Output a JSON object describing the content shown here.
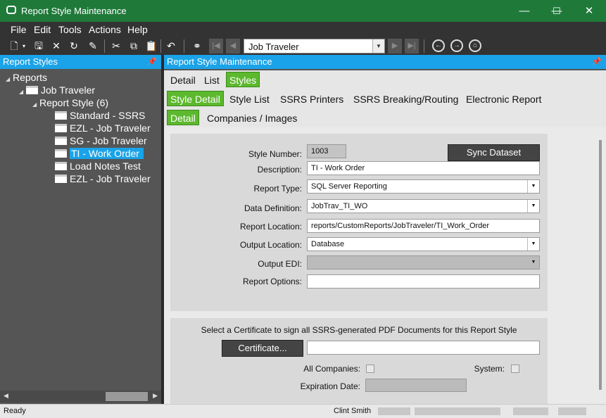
{
  "window": {
    "title": "Report Style Maintenance",
    "min": "—",
    "max": "☐",
    "close": "✕"
  },
  "menu": [
    "File",
    "Edit",
    "Tools",
    "Actions",
    "Help"
  ],
  "toolbar": {
    "nav_value": "Job Traveler"
  },
  "left_panel": {
    "title": "Report Styles",
    "tree": {
      "root": "Reports",
      "group": "Job Traveler",
      "subgroup": "Report Style (6)",
      "items": [
        "Standard - SSRS",
        "EZL - Job Traveler",
        "SG - Job Traveler",
        "TI - Work Order",
        "Load Notes Test",
        "EZL - Job Traveler"
      ],
      "selected_index": 3
    }
  },
  "right_panel": {
    "title": "Report Style Maintenance",
    "tabs_l1": [
      "Detail",
      "List",
      "Styles"
    ],
    "tabs_l2": [
      "Style Detail",
      "Style List",
      "SSRS Printers",
      "SSRS Breaking/Routing",
      "Electronic Report"
    ],
    "tabs_l3": [
      "Detail",
      "Companies / Images"
    ]
  },
  "form": {
    "style_number_label": "Style Number:",
    "style_number": "1003",
    "sync_button": "Sync Dataset",
    "description_label": "Description:",
    "description": "TI - Work Order",
    "report_type_label": "Report Type:",
    "report_type": "SQL Server Reporting",
    "data_definition_label": "Data Definition:",
    "data_definition": "JobTrav_TI_WO",
    "report_location_label": "Report Location:",
    "report_location": "reports/CustomReports/JobTraveler/TI_Work_Order",
    "output_location_label": "Output Location:",
    "output_location": "Database",
    "output_edi_label": "Output EDI:",
    "output_edi": "",
    "report_options_label": "Report Options:",
    "report_options": ""
  },
  "certificate": {
    "instruction": "Select a Certificate to sign all SSRS-generated PDF Documents for this Report Style",
    "button": "Certificate...",
    "value": "",
    "all_companies_label": "All Companies:",
    "system_label": "System:",
    "expiration_label": "Expiration Date:"
  },
  "status": {
    "left": "Ready",
    "user": "Clint Smith"
  }
}
